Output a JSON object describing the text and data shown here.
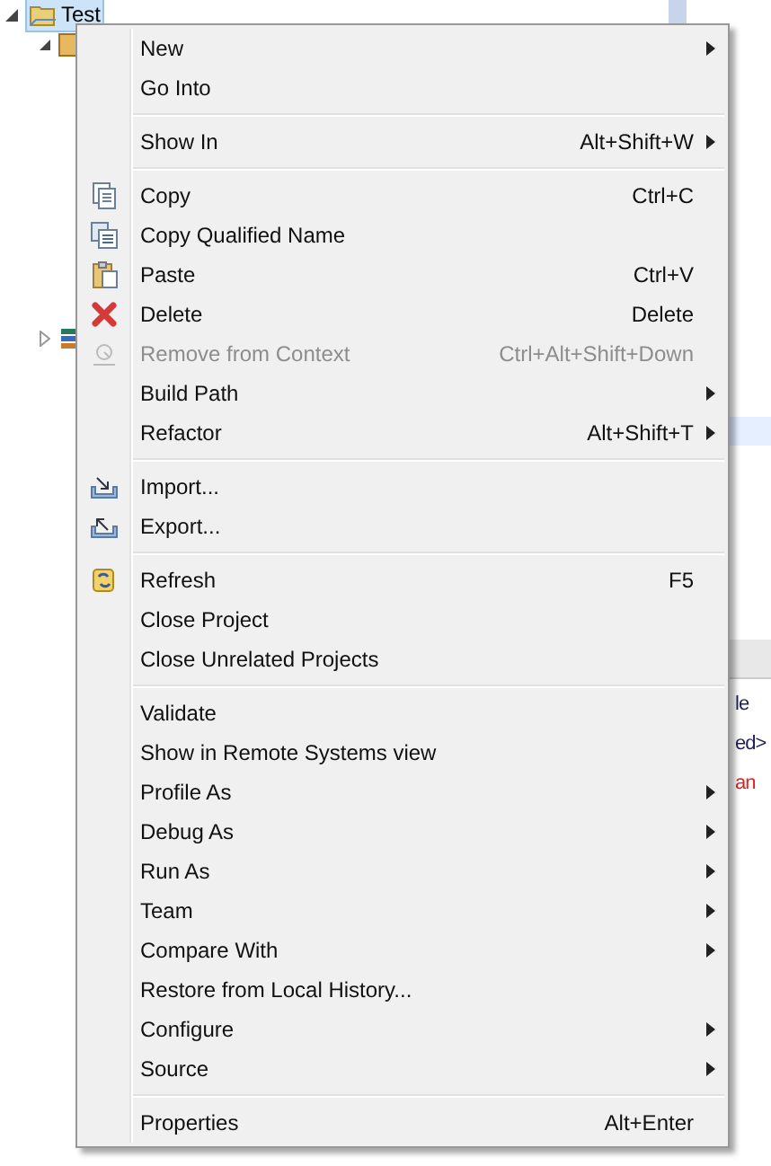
{
  "tree": {
    "items": [
      {
        "label": "Test",
        "selected": true,
        "expanded": true
      }
    ]
  },
  "right_panel": {
    "lines": [
      {
        "text": "le",
        "kind": "plain"
      },
      {
        "text": "ed>",
        "kind": "plain"
      },
      {
        "text": "an",
        "kind": "error"
      }
    ]
  },
  "context_menu": {
    "groups": [
      {
        "items": [
          {
            "label": "New",
            "submenu": true,
            "disabled": false
          },
          {
            "label": "Go Into",
            "submenu": false,
            "disabled": false
          }
        ]
      },
      {
        "items": [
          {
            "label": "Show In",
            "shortcut": "Alt+Shift+W",
            "submenu": true,
            "disabled": false
          }
        ]
      },
      {
        "items": [
          {
            "label": "Copy",
            "shortcut": "Ctrl+C",
            "kind": "copy",
            "submenu": false,
            "disabled": false
          },
          {
            "label": "Copy Qualified Name",
            "kind": "copy-qualified",
            "submenu": false,
            "disabled": false
          },
          {
            "label": "Paste",
            "shortcut": "Ctrl+V",
            "kind": "paste",
            "submenu": false,
            "disabled": false
          },
          {
            "label": "Delete",
            "shortcut": "Delete",
            "kind": "delete",
            "submenu": false,
            "disabled": false
          },
          {
            "label": "Remove from Context",
            "shortcut": "Ctrl+Alt+Shift+Down",
            "kind": "remove",
            "submenu": false,
            "disabled": true
          },
          {
            "label": "Build Path",
            "submenu": true,
            "disabled": false
          },
          {
            "label": "Refactor",
            "shortcut": "Alt+Shift+T",
            "submenu": true,
            "disabled": false
          }
        ]
      },
      {
        "items": [
          {
            "label": "Import...",
            "kind": "import",
            "submenu": false,
            "disabled": false
          },
          {
            "label": "Export...",
            "kind": "export",
            "submenu": false,
            "disabled": false
          }
        ]
      },
      {
        "items": [
          {
            "label": "Refresh",
            "shortcut": "F5",
            "kind": "refresh",
            "submenu": false,
            "disabled": false
          },
          {
            "label": "Close Project",
            "submenu": false,
            "disabled": false
          },
          {
            "label": "Close Unrelated Projects",
            "submenu": false,
            "disabled": false
          }
        ]
      },
      {
        "items": [
          {
            "label": "Validate",
            "submenu": false,
            "disabled": false
          },
          {
            "label": "Show in Remote Systems view",
            "submenu": false,
            "disabled": false
          },
          {
            "label": "Profile As",
            "submenu": true,
            "disabled": false
          },
          {
            "label": "Debug As",
            "submenu": true,
            "disabled": false
          },
          {
            "label": "Run As",
            "submenu": true,
            "disabled": false
          },
          {
            "label": "Team",
            "submenu": true,
            "disabled": false
          },
          {
            "label": "Compare With",
            "submenu": true,
            "disabled": false
          },
          {
            "label": "Restore from Local History...",
            "submenu": false,
            "disabled": false
          },
          {
            "label": "Configure",
            "submenu": true,
            "disabled": false
          },
          {
            "label": "Source",
            "submenu": true,
            "disabled": false
          }
        ]
      },
      {
        "items": [
          {
            "label": "Properties",
            "shortcut": "Alt+Enter",
            "submenu": false,
            "disabled": false
          }
        ]
      }
    ]
  }
}
